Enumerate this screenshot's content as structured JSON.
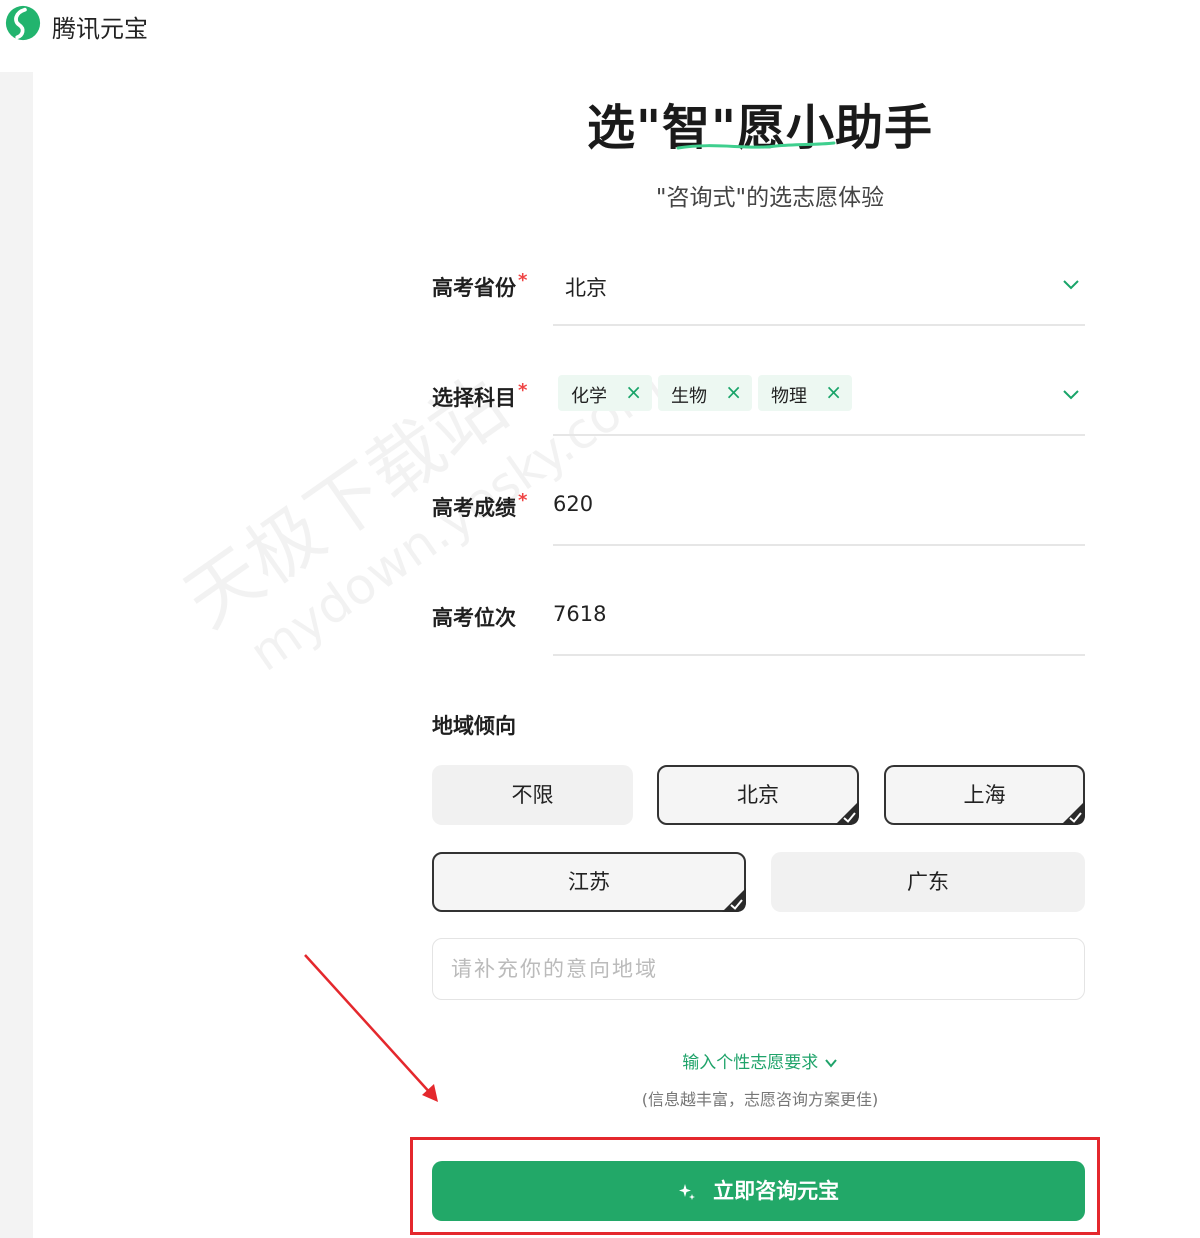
{
  "brand": {
    "name": "腾讯元宝"
  },
  "header": {
    "title": "选\"智\"愿小助手",
    "subtitle": "\"咨询式\"的选志愿体验"
  },
  "form": {
    "province": {
      "label": "高考省份",
      "required_mark": "*",
      "value": "北京",
      "icon": "chevron-down-icon"
    },
    "subjects": {
      "label": "选择科目",
      "required_mark": "*",
      "tags": [
        "化学",
        "生物",
        "物理"
      ],
      "remove_icon": "×",
      "icon": "chevron-down-icon"
    },
    "score": {
      "label": "高考成绩",
      "required_mark": "*",
      "value": "620"
    },
    "rank": {
      "label": "高考位次",
      "value": "7618"
    },
    "region": {
      "label": "地域倾向",
      "options": [
        {
          "label": "不限",
          "selected": false
        },
        {
          "label": "北京",
          "selected": true
        },
        {
          "label": "上海",
          "selected": true
        },
        {
          "label": "江苏",
          "selected": true
        },
        {
          "label": "广东",
          "selected": false
        }
      ],
      "supplement_placeholder": "请补充你的意向地域"
    }
  },
  "more": {
    "link_label": "输入个性志愿要求",
    "hint": "(信息越丰富，志愿咨询方案更佳)"
  },
  "submit": {
    "label": "立即咨询元宝",
    "icon": "sparkle-icon"
  },
  "watermark": {
    "line1": "天极下载站",
    "line2": "mydown.yesky.com"
  },
  "colors": {
    "accent": "#22a868",
    "required": "#ef4444",
    "annotation": "#e4282d"
  }
}
